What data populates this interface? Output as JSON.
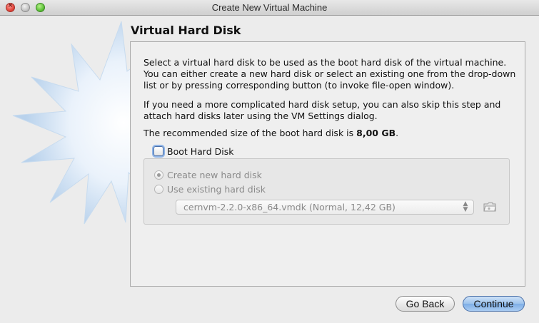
{
  "window": {
    "title": "Create New Virtual Machine",
    "controls": [
      "close-icon",
      "minimize-icon",
      "zoom-icon"
    ]
  },
  "page": {
    "title": "Virtual Hard Disk"
  },
  "content": {
    "paragraph1": "Select a virtual hard disk to be used as the boot hard disk of the virtual machine. You can either create a new hard disk or select an existing one from the drop-down list or by pressing corresponding button (to invoke file-open window).",
    "paragraph2": "If you need a more complicated hard disk setup, you can also skip this step and attach hard disks later using the VM Settings dialog.",
    "recommended_prefix": "The recommended size of the boot hard disk is ",
    "recommended_size": "8,00 GB",
    "recommended_suffix": "."
  },
  "boot_disk": {
    "checkbox_label": "Boot Hard Disk",
    "checked": false
  },
  "disk_options": {
    "create_new_label": "Create new hard disk",
    "use_existing_label": "Use existing hard disk",
    "selected": "create_new",
    "enabled": false
  },
  "disk_select": {
    "value": "cernvm-2.2.0-x86_64.vmdk (Normal, 12,42 GB)"
  },
  "buttons": {
    "back_label": "Go Back",
    "continue_label": "Continue"
  },
  "colors": {
    "accent": "#7eaee6",
    "background": "#ececec",
    "disabled_text": "#8a8a8a"
  }
}
